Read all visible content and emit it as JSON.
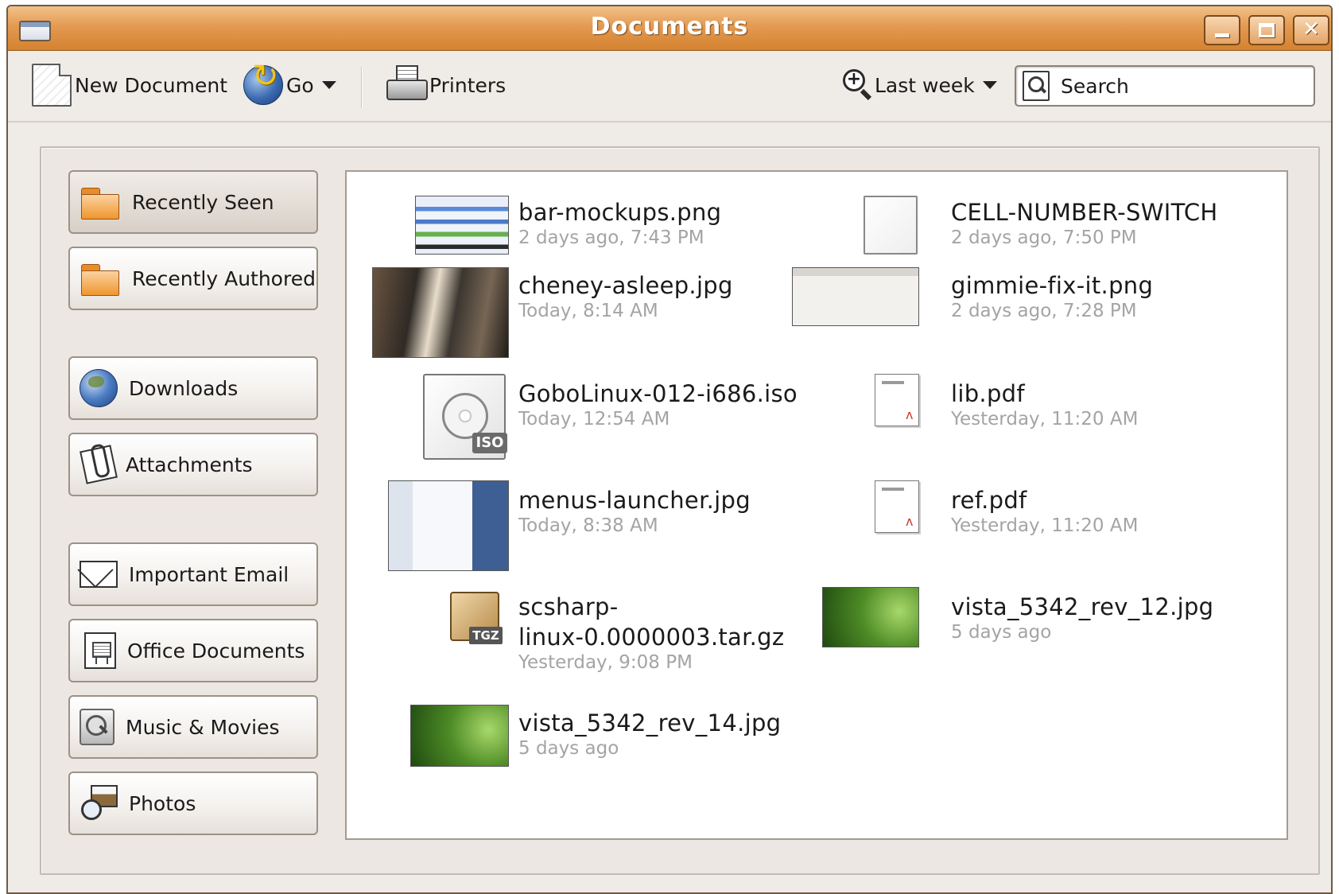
{
  "window": {
    "title": "Documents",
    "minimize_label": "_",
    "maximize_label": "□",
    "close_label": "✕"
  },
  "toolbar": {
    "new_document": "New Document",
    "go": "Go",
    "printers": "Printers",
    "time_filter": "Last week",
    "search_placeholder": "Search"
  },
  "sidebar": {
    "items": [
      {
        "label": "Recently Seen",
        "icon": "folder-icon",
        "active": true
      },
      {
        "label": "Recently Authored",
        "icon": "folder-icon"
      },
      {
        "label": "Downloads",
        "icon": "globe-icon"
      },
      {
        "label": "Attachments",
        "icon": "paperclip-icon"
      },
      {
        "label": "Important Email",
        "icon": "envelope-icon"
      },
      {
        "label": "Office Documents",
        "icon": "presentation-icon"
      },
      {
        "label": "Music & Movies",
        "icon": "media-search-icon"
      },
      {
        "label": "Photos",
        "icon": "photo-search-icon"
      }
    ]
  },
  "files": [
    {
      "name": "bar-mockups.png",
      "date": "2 days ago,  7:43 PM",
      "thumb": "image-thumbnail"
    },
    {
      "name": "CELL-NUMBER-SWITCH",
      "date": "2 days ago,  7:50 PM",
      "thumb": "blank-document-icon"
    },
    {
      "name": "cheney-asleep.jpg",
      "date": "Today,  8:14 AM",
      "thumb": "photo-thumbnail"
    },
    {
      "name": "gimmie-fix-it.png",
      "date": "2 days ago,  7:28 PM",
      "thumb": "image-thumbnail"
    },
    {
      "name": "GoboLinux-012-i686.iso",
      "date": "Today, 12:54 AM",
      "thumb": "disc-image-icon",
      "badge": "ISO"
    },
    {
      "name": "lib.pdf",
      "date": "Yesterday, 11:20 AM",
      "thumb": "pdf-document-icon"
    },
    {
      "name": "menus-launcher.jpg",
      "date": "Today,  8:38 AM",
      "thumb": "image-thumbnail"
    },
    {
      "name": "ref.pdf",
      "date": "Yesterday, 11:20 AM",
      "thumb": "pdf-document-icon"
    },
    {
      "name_line1": "scsharp-",
      "name_line2": "linux-0.0000003.tar.gz",
      "date": "Yesterday,  9:08 PM",
      "thumb": "archive-icon",
      "badge": "TGZ"
    },
    {
      "name": "vista_5342_rev_12.jpg",
      "date": "5 days ago",
      "thumb": "image-thumbnail"
    },
    {
      "name": "vista_5342_rev_14.jpg",
      "date": "5 days ago",
      "thumb": "image-thumbnail"
    }
  ]
}
